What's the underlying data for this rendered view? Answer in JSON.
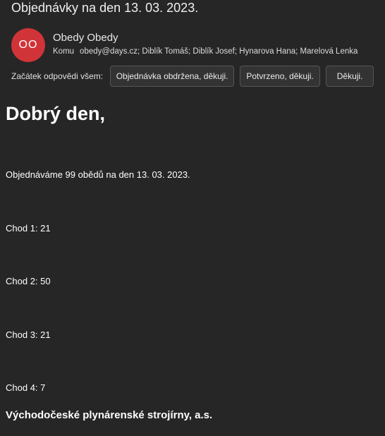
{
  "email": {
    "subject": "Objednávky na den 13. 03. 2023.",
    "sender": {
      "initials": "OO",
      "name": "Obedy Obedy",
      "avatar_color": "#d13438"
    },
    "to_label": "Komu",
    "recipients": "obedy@days.cz; Diblík Tomáš; Diblík Josef; Hynarova Hana; Marelová Lenka"
  },
  "quick_reply": {
    "label": "Začátek odpovědi všem:",
    "buttons": [
      "Objednávka obdržena, děkuji.",
      "Potvrzeno, děkuji.",
      "Děkuji."
    ]
  },
  "body": {
    "greeting": "Dobrý den,",
    "intro": "Objednáváme 99 obědů na den 13. 03. 2023.",
    "courses": [
      "Chod 1: 21",
      "Chod 2: 50",
      "Chod 3: 21",
      "Chod 4: 7"
    ],
    "signature": "Východočeské plynárenské strojírny, a.s."
  }
}
